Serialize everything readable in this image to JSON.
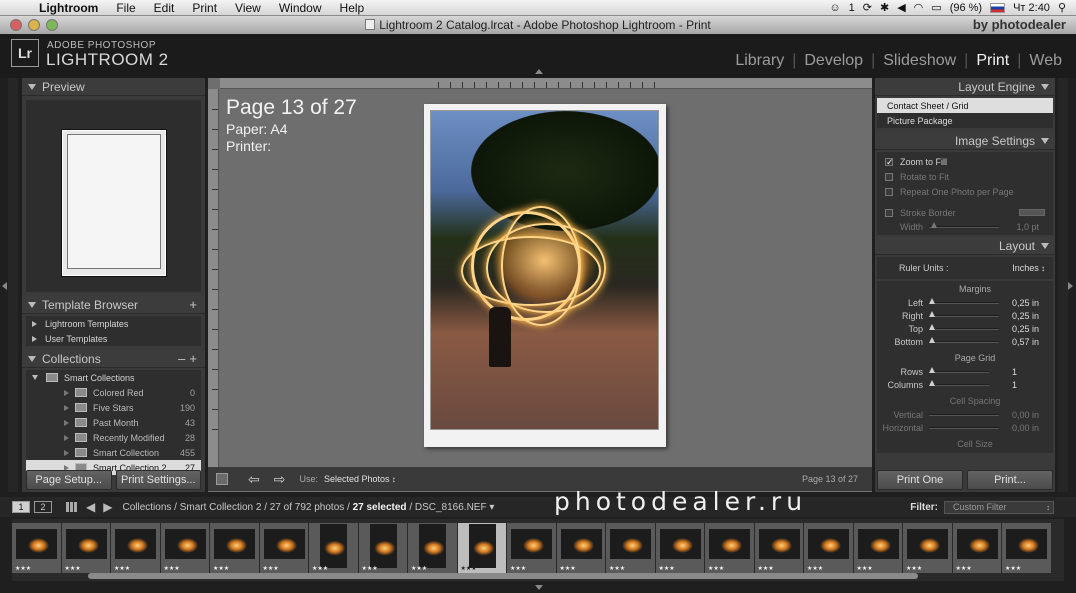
{
  "menubar": {
    "app": "Lightroom",
    "items": [
      "File",
      "Edit",
      "Print",
      "View",
      "Window",
      "Help"
    ],
    "status_count": "1",
    "battery": "(96 %)",
    "clock": "Чт 2:40"
  },
  "window": {
    "title": "Lightroom 2 Catalog.lrcat - Adobe Photoshop Lightroom - Print",
    "brand": "by photodealer"
  },
  "header": {
    "logo": "Lr",
    "product_line1": "ADOBE PHOTOSHOP",
    "product_line2": "LIGHTROOM 2",
    "modules": [
      "Library",
      "Develop",
      "Slideshow",
      "Print",
      "Web"
    ],
    "active_module": "Print"
  },
  "left": {
    "preview_title": "Preview",
    "template_title": "Template Browser",
    "templates": [
      "Lightroom Templates",
      "User Templates"
    ],
    "collections_title": "Collections",
    "smart_collections": "Smart Collections",
    "collections": [
      {
        "name": "Colored Red",
        "count": "0"
      },
      {
        "name": "Five Stars",
        "count": "190"
      },
      {
        "name": "Past Month",
        "count": "43"
      },
      {
        "name": "Recently Modified",
        "count": "28"
      },
      {
        "name": "Smart Collection",
        "count": "455"
      },
      {
        "name": "Smart Collection 2",
        "count": "27"
      }
    ],
    "page_setup": "Page Setup...",
    "print_settings": "Print Settings..."
  },
  "center": {
    "page_label": "Page 13 of 27",
    "paper_label": "Paper:  A4",
    "printer_label": "Printer:",
    "use_label": "Use:",
    "use_value": "Selected Photos",
    "page_counter": "Page 13 of 27"
  },
  "right": {
    "layout_engine_title": "Layout Engine",
    "engines": [
      "Contact Sheet / Grid",
      "Picture Package"
    ],
    "image_settings_title": "Image Settings",
    "zoom_to_fill": "Zoom to Fill",
    "rotate_to_fit": "Rotate to Fit",
    "repeat_one": "Repeat One Photo per Page",
    "stroke_border": "Stroke Border",
    "width_label": "Width",
    "width_value": "1,0 pt",
    "layout_title": "Layout",
    "ruler_units_label": "Ruler Units :",
    "ruler_units_value": "Inches",
    "margins_title": "Margins",
    "margins": [
      {
        "label": "Left",
        "value": "0,25 in"
      },
      {
        "label": "Right",
        "value": "0,25 in"
      },
      {
        "label": "Top",
        "value": "0,25 in"
      },
      {
        "label": "Bottom",
        "value": "0,57 in"
      }
    ],
    "page_grid_title": "Page Grid",
    "rows_label": "Rows",
    "rows_value": "1",
    "columns_label": "Columns",
    "columns_value": "1",
    "cell_spacing_title": "Cell Spacing",
    "vertical_label": "Vertical",
    "vertical_value": "0,00 in",
    "horizontal_label": "Horizontal",
    "horizontal_value": "0,00 in",
    "cell_size_title": "Cell Size",
    "print_one": "Print One",
    "print": "Print..."
  },
  "filmstrip": {
    "screen1": "1",
    "screen2": "2",
    "path_prefix": "Collections / Smart Collection 2 / 27 of 792 photos /",
    "path_selected": "27 selected",
    "path_file": "/ DSC_8166.NEF",
    "filter_label": "Filter:",
    "filter_value": "Custom Filter",
    "thumb_rating": "★★★",
    "watermark": "photodealer.ru"
  }
}
